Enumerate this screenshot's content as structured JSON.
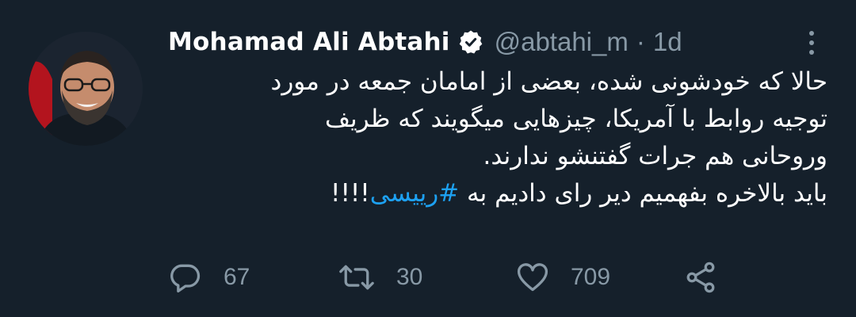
{
  "tweet": {
    "author": {
      "display_name": "Mohamad Ali Abtahi",
      "handle": "@abtahi_m",
      "verified": true
    },
    "separator": "·",
    "timestamp": "1d",
    "text_lines": [
      "حالا که خودشونی شده، بعضی از امامان جمعه در مورد",
      "توجیه روابط با آمریکا، چیزهایی میگویند که ظریف",
      "وروحانی هم جرات گفتنشو ندارند."
    ],
    "last_line": {
      "prefix": "باید بالاخره بفهمیم دیر رای دادیم به ",
      "hashtag": "#رییسی",
      "suffix": "!!!!"
    },
    "actions": {
      "reply_count": "67",
      "retweet_count": "30",
      "like_count": "709"
    }
  },
  "icons": {
    "verified": "verified-badge-icon",
    "more": "more-vertical-icon",
    "reply": "reply-icon",
    "retweet": "retweet-icon",
    "like": "heart-icon",
    "share": "share-icon"
  },
  "colors": {
    "background": "#15202b",
    "primary_text": "#ffffff",
    "secondary_text": "#8899a6",
    "link": "#1da1f2"
  }
}
